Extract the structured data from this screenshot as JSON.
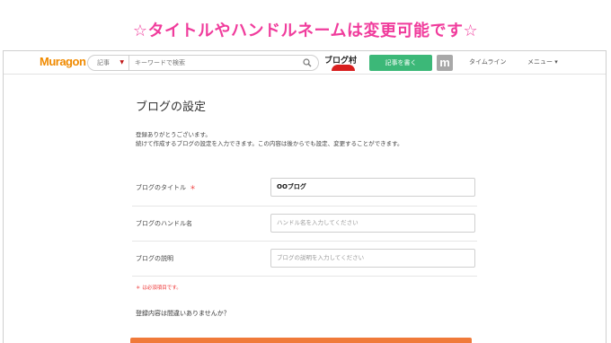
{
  "banner": {
    "text": "☆タイトルやハンドルネームは変更可能です☆"
  },
  "colors": {
    "banner_pink": "#f03c9c",
    "brand_orange": "#f08a00",
    "write_green": "#3cb878",
    "required_red": "#e33333",
    "submit_orange": "#f07a3a"
  },
  "header": {
    "logo": "Muragon",
    "search_category": "記事",
    "search_placeholder": "キーワードで検索",
    "blogmura_logo": "ブログ村",
    "write_button": "記事を書く",
    "m_icon": "m",
    "nav_timeline": "タイムライン",
    "nav_menu": "メニュー ▾"
  },
  "page": {
    "title": "ブログの設定",
    "intro_line1": "登録ありがとうございます。",
    "intro_line2": "続けて作成するブログの設定を入力できます。この内容は後からでも設定、変更することができます。",
    "required_note": "＊ は必須項目です。",
    "confirm": "登録内容は間違いありませんか？"
  },
  "form": {
    "title_label": "ブログのタイトル",
    "required_mark": "＊",
    "title_value": "OOブログ",
    "handle_label": "ブログのハンドル名",
    "handle_placeholder": "ハンドル名を入力してください",
    "desc_label": "ブログの説明",
    "desc_placeholder": "ブログの説明を入力してください"
  }
}
